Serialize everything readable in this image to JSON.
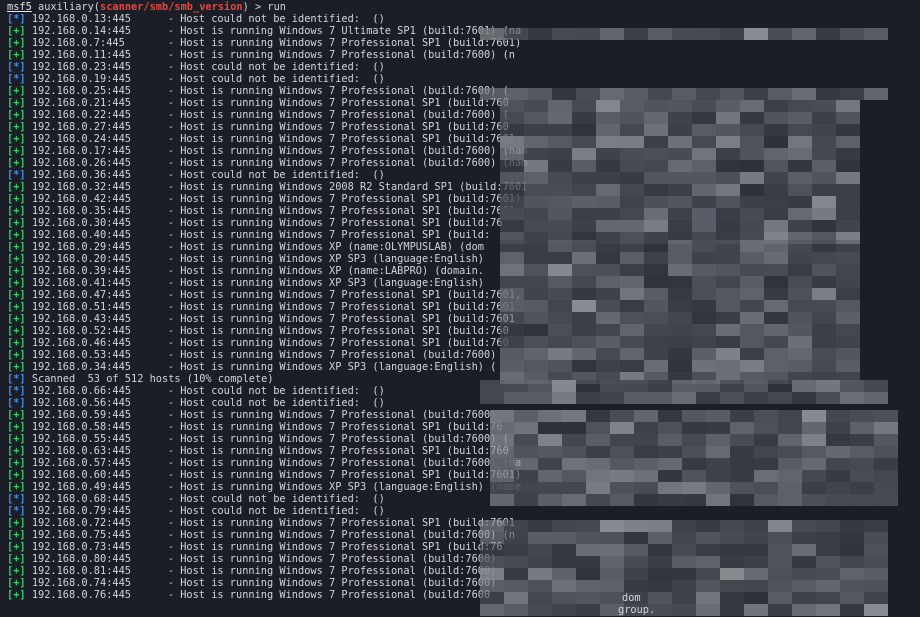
{
  "prompt": {
    "name": "msf5",
    "prefix": " auxiliary(",
    "module": "scanner/smb/smb_version",
    "suffix": ") > run"
  },
  "lines": [
    {
      "s": "*",
      "ip": "192.168.0.13:445",
      "msg": "- Host could not be identified:  ()"
    },
    {
      "s": "+",
      "ip": "192.168.0.14:445",
      "msg": "- Host is running Windows 7 Ultimate SP1 (build:7601) (na"
    },
    {
      "s": "+",
      "ip": "192.168.0.7:445",
      "msg": "- Host is running Windows 7 Professional SP1 (build:7601)"
    },
    {
      "s": "+",
      "ip": "192.168.0.11:445",
      "msg": "- Host is running Windows 7 Professional (build:7600) (n"
    },
    {
      "s": "*",
      "ip": "192.168.0.23:445",
      "msg": "- Host could not be identified:  ()"
    },
    {
      "s": "*",
      "ip": "192.168.0.19:445",
      "msg": "- Host could not be identified:  ()"
    },
    {
      "s": "+",
      "ip": "192.168.0.25:445",
      "msg": "- Host is running Windows 7 Professional (build:7600) ("
    },
    {
      "s": "+",
      "ip": "192.168.0.21:445",
      "msg": "- Host is running Windows 7 Professional SP1 (build:760"
    },
    {
      "s": "+",
      "ip": "192.168.0.22:445",
      "msg": "- Host is running Windows 7 Professional (build:7600) ("
    },
    {
      "s": "+",
      "ip": "192.168.0.27:445",
      "msg": "- Host is running Windows 7 Professional SP1 (build:760"
    },
    {
      "s": "+",
      "ip": "192.168.0.24:445",
      "msg": "- Host is running Windows 7 Professional SP1 (build:7601,"
    },
    {
      "s": "+",
      "ip": "192.168.0.17:445",
      "msg": "- Host is running Windows 7 Professional (build:7600) (nam"
    },
    {
      "s": "+",
      "ip": "192.168.0.26:445",
      "msg": "- Host is running Windows 7 Professional (build:7600) (nam"
    },
    {
      "s": "*",
      "ip": "192.168.0.36:445",
      "msg": "- Host could not be identified:  ()"
    },
    {
      "s": "+",
      "ip": "192.168.0.32:445",
      "msg": "- Host is running Windows 2008 R2 Standard SP1 (build:7601"
    },
    {
      "s": "+",
      "ip": "192.168.0.42:445",
      "msg": "- Host is running Windows 7 Professional SP1 (build:7601)"
    },
    {
      "s": "+",
      "ip": "192.168.0.35:445",
      "msg": "- Host is running Windows 7 Professional SP1 (build:7601"
    },
    {
      "s": "+",
      "ip": "192.168.0.30:445",
      "msg": "- Host is running Windows 7 Professional SP1 (build:76"
    },
    {
      "s": "+",
      "ip": "192.168.0.40:445",
      "msg": "- Host is running Windows 7 Professional SP1 (build:"
    },
    {
      "s": "+",
      "ip": "192.168.0.29:445",
      "msg": "- Host is running Windows XP (name:OLYMPUSLAB) (dom"
    },
    {
      "s": "+",
      "ip": "192.168.0.20:445",
      "msg": "- Host is running Windows XP SP3 (language:English)"
    },
    {
      "s": "+",
      "ip": "192.168.0.39:445",
      "msg": "- Host is running Windows XP (name:LABPRO) (domain."
    },
    {
      "s": "+",
      "ip": "192.168.0.41:445",
      "msg": "- Host is running Windows XP SP3 (language:English)"
    },
    {
      "s": "+",
      "ip": "192.168.0.47:445",
      "msg": "- Host is running Windows 7 Professional SP1 (build:7601,"
    },
    {
      "s": "+",
      "ip": "192.168.0.51:445",
      "msg": "- Host is running Windows 7 Professional SP1 (build:7601"
    },
    {
      "s": "+",
      "ip": "192.168.0.43:445",
      "msg": "- Host is running Windows 7 Professional SP1 (build:7601"
    },
    {
      "s": "+",
      "ip": "192.168.0.52:445",
      "msg": "- Host is running Windows 7 Professional SP1 (build:760"
    },
    {
      "s": "+",
      "ip": "192.168.0.46:445",
      "msg": "- Host is running Windows 7 Professional SP1 (build:760"
    },
    {
      "s": "+",
      "ip": "192.168.0.53:445",
      "msg": "- Host is running Windows 7 Professional (build:7600)"
    },
    {
      "s": "+",
      "ip": "192.168.0.34:445",
      "msg": "- Host is running Windows XP SP3 (language:English) ("
    },
    {
      "s": "*",
      "ip": "",
      "msg": "Scanned  53 of 512 hosts (10% complete)"
    },
    {
      "s": "*",
      "ip": "192.168.0.66:445",
      "msg": "- Host could not be identified:  ()"
    },
    {
      "s": "*",
      "ip": "192.168.0.56:445",
      "msg": "- Host could not be identified:  ()"
    },
    {
      "s": "+",
      "ip": "192.168.0.59:445",
      "msg": "- Host is running Windows 7 Professional (build:7600)"
    },
    {
      "s": "+",
      "ip": "192.168.0.58:445",
      "msg": "- Host is running Windows 7 Professional SP1 (build:76"
    },
    {
      "s": "+",
      "ip": "192.168.0.55:445",
      "msg": "- Host is running Windows 7 Professional (build:7600) ("
    },
    {
      "s": "+",
      "ip": "192.168.0.63:445",
      "msg": "- Host is running Windows 7 Professional SP1 (build:760"
    },
    {
      "s": "+",
      "ip": "192.168.0.57:445",
      "msg": "- Host is running Windows 7 Professional (build:7600) (na"
    },
    {
      "s": "+",
      "ip": "192.168.0.60:445",
      "msg": "- Host is running Windows 7 Professional SP1 (build:7601)"
    },
    {
      "s": "+",
      "ip": "192.168.0.49:445",
      "msg": "- Host is running Windows XP SP3 (language:English) (name"
    },
    {
      "s": "*",
      "ip": "192.168.0.68:445",
      "msg": "- Host could not be identified:  ()"
    },
    {
      "s": "*",
      "ip": "192.168.0.79:445",
      "msg": "- Host could not be identified:  ()"
    },
    {
      "s": "+",
      "ip": "192.168.0.72:445",
      "msg": "- Host is running Windows 7 Professional SP1 (build:7601"
    },
    {
      "s": "+",
      "ip": "192.168.0.75:445",
      "msg": "- Host is running Windows 7 Professional (build:7600) (n"
    },
    {
      "s": "+",
      "ip": "192.168.0.73:445",
      "msg": "- Host is running Windows 7 Professional SP1 (build:76"
    },
    {
      "s": "+",
      "ip": "192.168.0.80:445",
      "msg": "- Host is running Windows 7 Professional (build:7600)"
    },
    {
      "s": "+",
      "ip": "192.168.0.81:445",
      "msg": "- Host is running Windows 7 Professional (build:7600)"
    },
    {
      "s": "+",
      "ip": "192.168.0.74:445",
      "msg": "- Host is running Windows 7 Professional (build:7600)"
    },
    {
      "s": "+",
      "ip": "192.168.0.76:445",
      "msg": "- Host is running Windows 7 Professional (build:7600"
    }
  ],
  "fragments": [
    "dom",
    "group."
  ],
  "colors": {
    "background": "#1b1e26",
    "text": "#d2d4d8",
    "success": "#37c96b",
    "info": "#3f8ff0",
    "module": "#e5473c"
  }
}
